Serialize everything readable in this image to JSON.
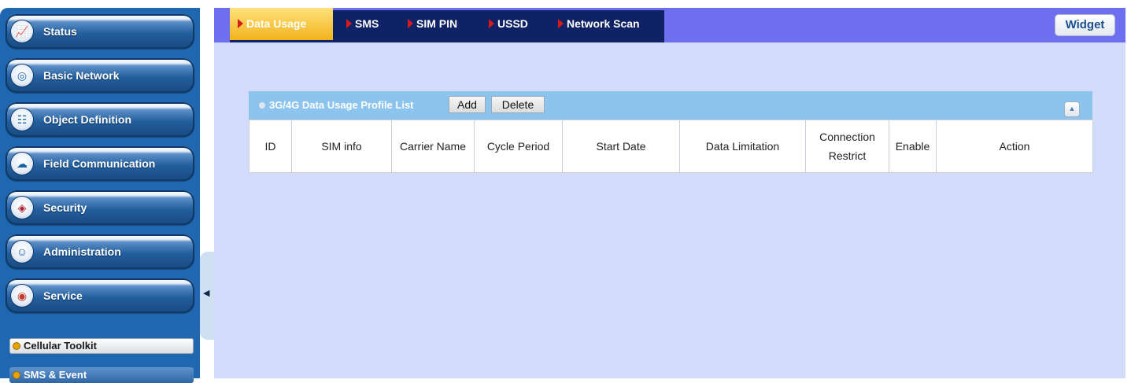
{
  "sidebar": {
    "items": [
      {
        "label": "Status",
        "icon": "chart-icon"
      },
      {
        "label": "Basic Network",
        "icon": "globe-icon"
      },
      {
        "label": "Object Definition",
        "icon": "network-icon"
      },
      {
        "label": "Field Communication",
        "icon": "field-comm-icon"
      },
      {
        "label": "Security",
        "icon": "shield-icon"
      },
      {
        "label": "Administration",
        "icon": "admin-icon"
      },
      {
        "label": "Service",
        "icon": "service-icon"
      }
    ],
    "subitems": [
      {
        "label": "Cellular Toolkit",
        "active": true
      },
      {
        "label": "SMS & Event",
        "active": false
      }
    ],
    "collapse_glyph": "◀"
  },
  "tabs": [
    {
      "label": "Data Usage",
      "active": true
    },
    {
      "label": "SMS",
      "active": false
    },
    {
      "label": "SIM PIN",
      "active": false
    },
    {
      "label": "USSD",
      "active": false
    },
    {
      "label": "Network Scan",
      "active": false
    }
  ],
  "widget_label": "Widget",
  "panel": {
    "title": "3G/4G Data Usage Profile List",
    "add_label": "Add",
    "delete_label": "Delete",
    "collapse_glyph": "▲",
    "columns": [
      "ID",
      "SIM info",
      "Carrier Name",
      "Cycle Period",
      "Start Date",
      "Data Limitation",
      "Connection Restrict",
      "Enable",
      "Action"
    ]
  },
  "colors": {
    "sidebar_bg": "#1f67b0",
    "main_bg": "#d2dcfa",
    "tabbar_bg": "#6d6ff0",
    "tabgroup_bg": "#0f2266",
    "active_tab": "#f2b21d",
    "tab_arrow": "#d61b1b",
    "panel_header": "#8cc4ee"
  }
}
